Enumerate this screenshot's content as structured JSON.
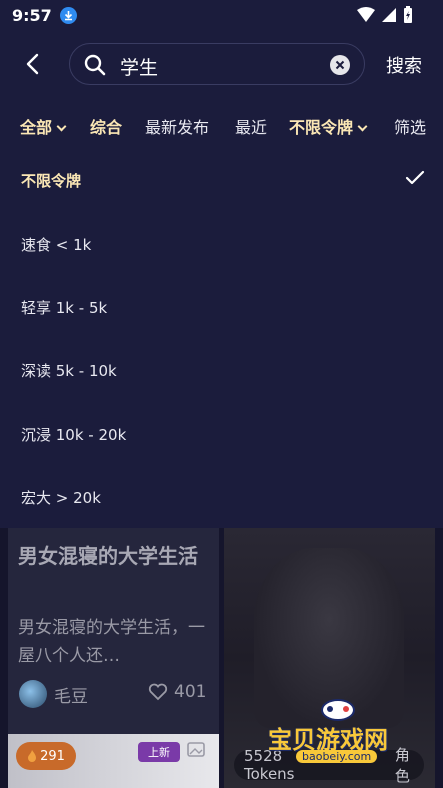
{
  "status_bar": {
    "time": "9:57"
  },
  "search": {
    "value": "学生",
    "submit_label": "搜索"
  },
  "filters": {
    "all_label": "全部",
    "comprehensive_label": "综合",
    "latest_label": "最新发布",
    "recent_label": "最近",
    "token_filter_label": "不限令牌",
    "screen_label": "筛选"
  },
  "dropdown": {
    "options": [
      {
        "label": "不限令牌",
        "selected": true
      },
      {
        "label": "速食 < 1k",
        "selected": false
      },
      {
        "label": "轻享 1k - 5k",
        "selected": false
      },
      {
        "label": "深读 5k - 10k",
        "selected": false
      },
      {
        "label": "沉浸 10k - 20k",
        "selected": false
      },
      {
        "label": "宏大 > 20k",
        "selected": false
      }
    ]
  },
  "results": {
    "card1": {
      "title": "男女混寝的大学生活",
      "description": "男女混寝的大学生活，一屋八个人还…",
      "author": "毛豆",
      "likes": "401"
    },
    "card2": {
      "hot_count": "291",
      "new_badge": "上新"
    },
    "card3": {
      "tokens": "5528 Tokens",
      "role": "角色"
    }
  },
  "watermark": {
    "text": "宝贝游戏网",
    "url": "baobeiy.com"
  },
  "colors": {
    "background": "#1b1c3c",
    "accent": "#fbe7b5",
    "download_badge": "#2f8bf0"
  }
}
